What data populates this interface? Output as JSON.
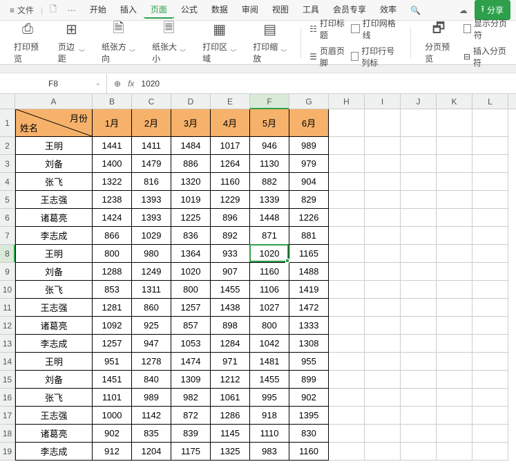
{
  "menu": {
    "file": "文件",
    "tabs": [
      "开始",
      "插入",
      "页面",
      "公式",
      "数据",
      "审阅",
      "视图",
      "工具",
      "会员专享",
      "效率"
    ],
    "active_index": 2,
    "share": "分享"
  },
  "ribbon": {
    "print_preview": "打印预览",
    "margins": "页边距",
    "orientation": "纸张方向",
    "size": "纸张大小",
    "area": "打印区域",
    "scale": "打印缩放",
    "print_titles": "打印标题",
    "header_footer": "页眉页脚",
    "gridlines": "打印网格线",
    "headings": "打印行号列标",
    "page_break_preview": "分页预览",
    "show_breaks": "显示分页符",
    "insert_break": "插入分页符"
  },
  "formula": {
    "cell_ref": "F8",
    "fx": "fx",
    "value": "1020"
  },
  "columns": [
    "A",
    "B",
    "C",
    "D",
    "E",
    "F",
    "G",
    "H",
    "I",
    "J",
    "K",
    "L"
  ],
  "active_col": "F",
  "active_row": 8,
  "header_corner": {
    "month": "月份",
    "name": "姓名"
  },
  "months": [
    "1月",
    "2月",
    "3月",
    "4月",
    "5月",
    "6月"
  ],
  "rows": [
    {
      "name": "王明",
      "vals": [
        1441,
        1411,
        1484,
        1017,
        946,
        989
      ]
    },
    {
      "name": "刘备",
      "vals": [
        1400,
        1479,
        886,
        1264,
        1130,
        979
      ]
    },
    {
      "name": "张飞",
      "vals": [
        1322,
        816,
        1320,
        1160,
        882,
        904
      ]
    },
    {
      "name": "王志强",
      "vals": [
        1238,
        1393,
        1019,
        1229,
        1339,
        829
      ]
    },
    {
      "name": "诸葛亮",
      "vals": [
        1424,
        1393,
        1225,
        896,
        1448,
        1226
      ]
    },
    {
      "name": "李志成",
      "vals": [
        866,
        1029,
        836,
        892,
        871,
        881
      ]
    },
    {
      "name": "王明",
      "vals": [
        800,
        980,
        1364,
        933,
        1020,
        1165
      ]
    },
    {
      "name": "刘备",
      "vals": [
        1288,
        1249,
        1020,
        907,
        1160,
        1488
      ]
    },
    {
      "name": "张飞",
      "vals": [
        853,
        1311,
        800,
        1455,
        1106,
        1419
      ]
    },
    {
      "name": "王志强",
      "vals": [
        1281,
        860,
        1257,
        1438,
        1027,
        1472
      ]
    },
    {
      "name": "诸葛亮",
      "vals": [
        1092,
        925,
        857,
        898,
        800,
        1333
      ]
    },
    {
      "name": "李志成",
      "vals": [
        1257,
        947,
        1053,
        1284,
        1042,
        1308
      ]
    },
    {
      "name": "王明",
      "vals": [
        951,
        1278,
        1474,
        971,
        1481,
        955
      ]
    },
    {
      "name": "刘备",
      "vals": [
        1451,
        840,
        1309,
        1212,
        1455,
        899
      ]
    },
    {
      "name": "张飞",
      "vals": [
        1101,
        989,
        982,
        1061,
        995,
        902
      ]
    },
    {
      "name": "王志强",
      "vals": [
        1000,
        1142,
        872,
        1286,
        918,
        1395
      ]
    },
    {
      "name": "诸葛亮",
      "vals": [
        902,
        835,
        839,
        1145,
        1110,
        830
      ]
    },
    {
      "name": "李志成",
      "vals": [
        912,
        1204,
        1175,
        1325,
        983,
        1160
      ]
    }
  ]
}
